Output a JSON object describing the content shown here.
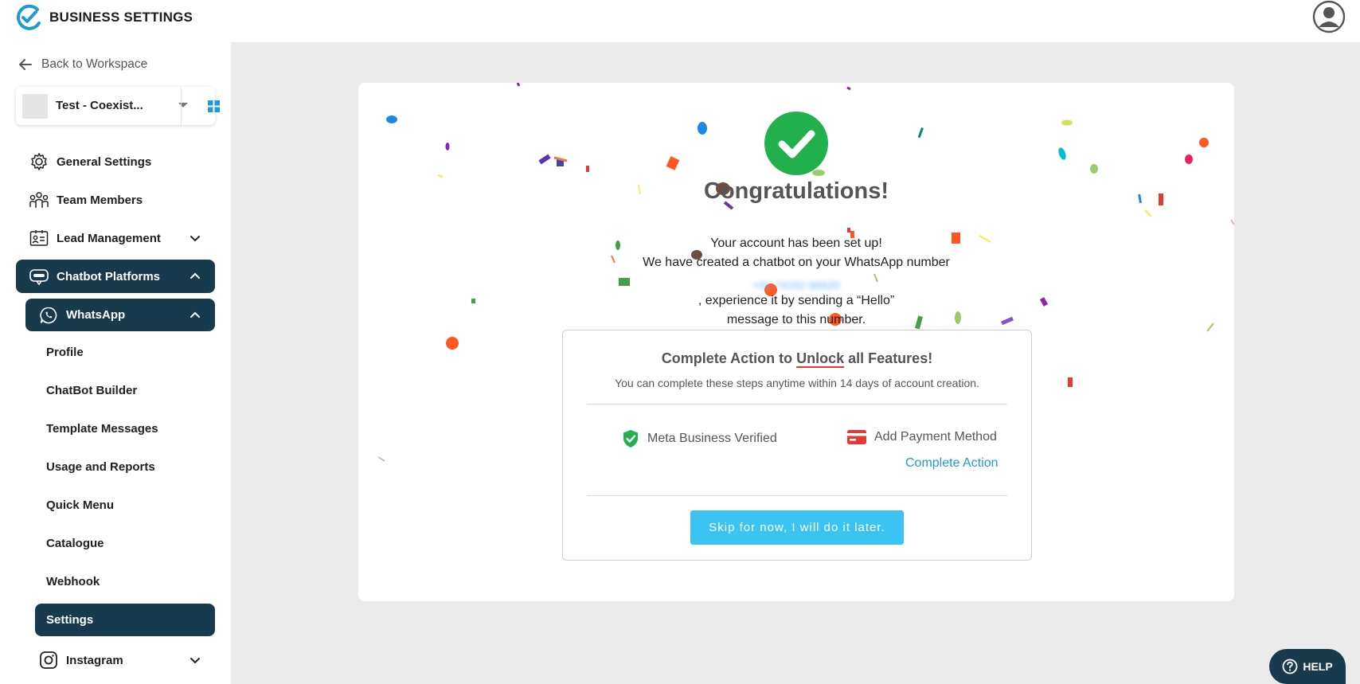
{
  "header": {
    "title": "BUSINESS SETTINGS",
    "logo_icon": "check-circle-logo-icon",
    "avatar_icon": "user-avatar-icon"
  },
  "sidebar": {
    "back_label": "Back to Workspace",
    "workspace_name": "Test - Coexist...",
    "items": [
      {
        "label": "General Settings",
        "icon": "gear-icon"
      },
      {
        "label": "Team Members",
        "icon": "team-icon"
      },
      {
        "label": "Lead Management",
        "icon": "id-card-icon"
      },
      {
        "label": "Chatbot Platforms",
        "icon": "chatbot-icon"
      },
      {
        "label": "WhatsApp",
        "icon": "whatsapp-icon"
      }
    ],
    "whatsapp_sub": [
      {
        "label": "Profile"
      },
      {
        "label": "ChatBot Builder"
      },
      {
        "label": "Template Messages"
      },
      {
        "label": "Usage and Reports"
      },
      {
        "label": "Quick Menu"
      },
      {
        "label": "Catalogue"
      },
      {
        "label": "Webhook"
      },
      {
        "label": "Settings"
      }
    ],
    "instagram_label": "Instagram"
  },
  "modal": {
    "title": "Congratulations!",
    "line1": "Your account has been set up!",
    "line2": "We have created a chatbot on your WhatsApp number",
    "phone_blurred": "+91 74152 66820",
    "line3": ", experience it by sending a “Hello”",
    "line4": "message to this number.",
    "action_title_pre": "Complete Action to ",
    "action_title_u": "Unlock",
    "action_title_post": " all Features!",
    "action_sub": "You can complete these steps anytime within 14 days of account creation.",
    "step_verified": "Meta Business Verified",
    "step_payment": "Add Payment Method",
    "complete_action": "Complete Action",
    "skip_button": "Skip for now, I will do it later."
  },
  "help": {
    "label": "HELP"
  },
  "colors": {
    "accent": "#173a4d",
    "success": "#21b04b",
    "link": "#1e9bd7",
    "button": "#3bc4f3"
  }
}
